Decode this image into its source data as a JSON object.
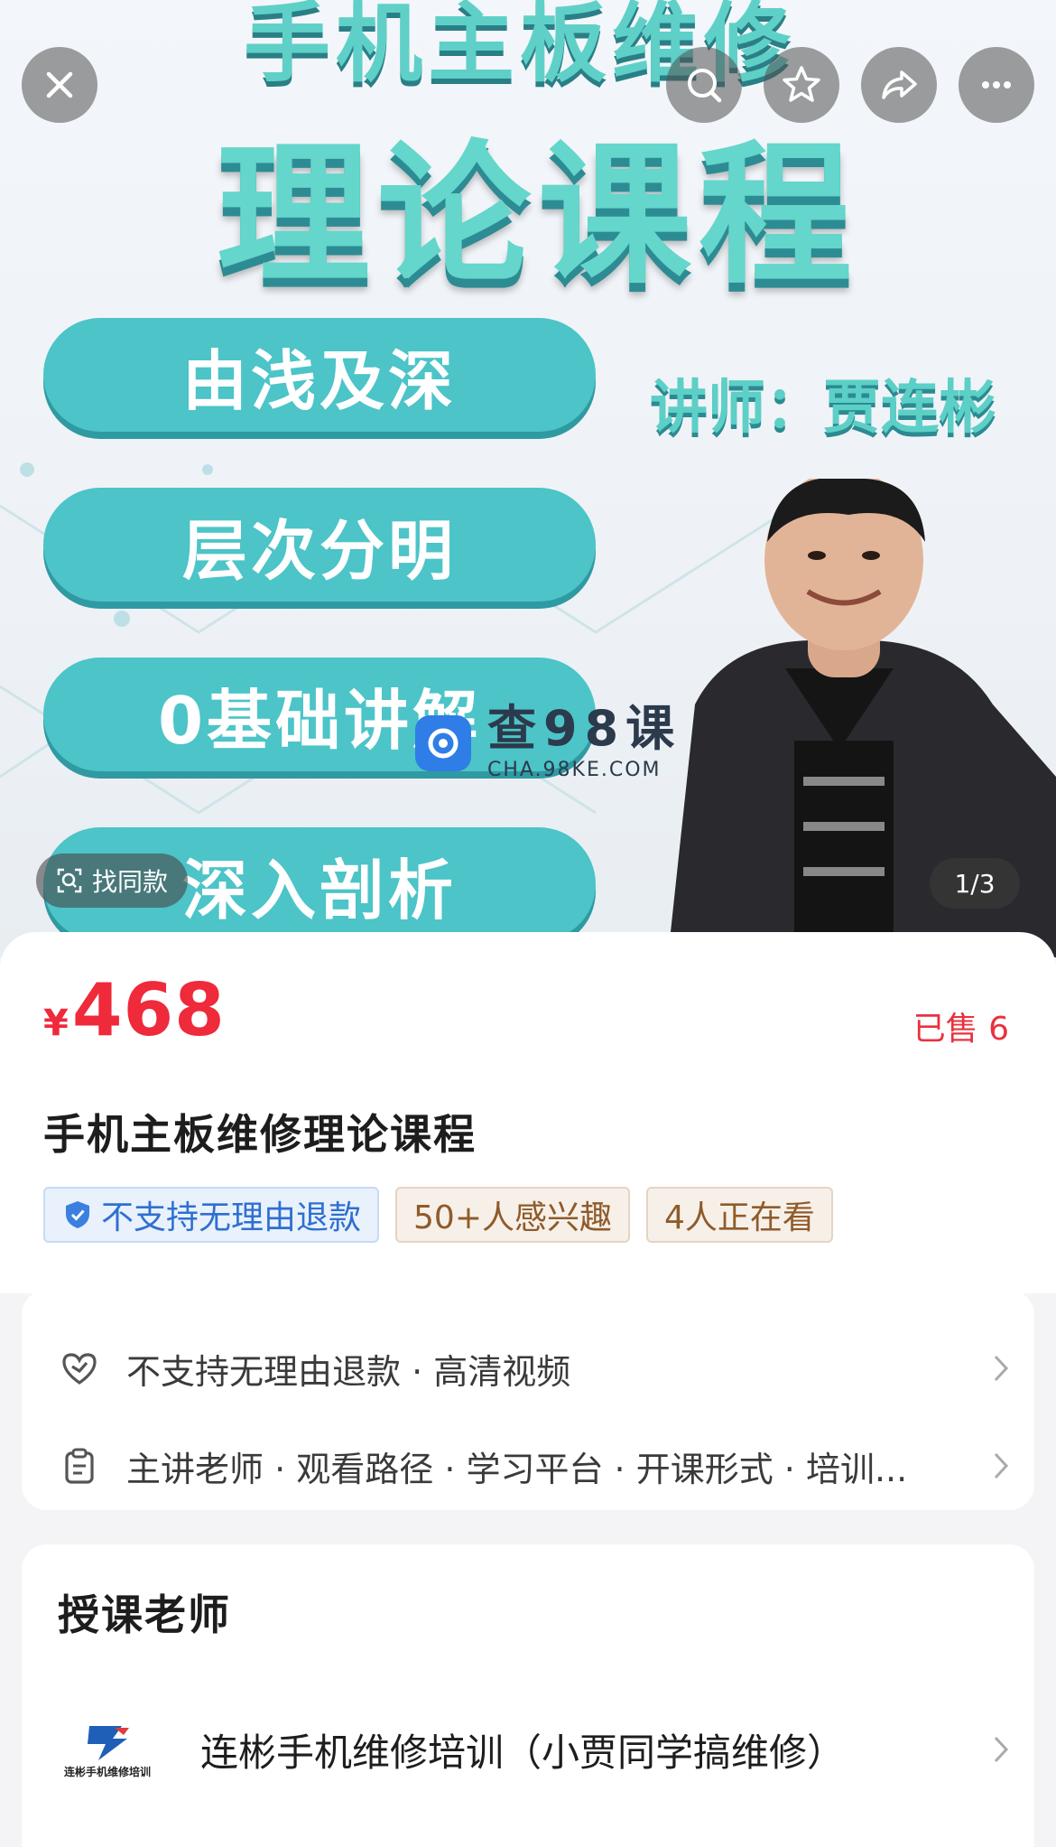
{
  "hero": {
    "top_text": "手机主板维修",
    "title": "理论课程",
    "pills": [
      "由浅及深",
      "层次分明",
      "0基础讲解",
      "深入剖析"
    ],
    "teacher_line": "讲师：贾连彬",
    "watermark_main": "查98课",
    "watermark_sub": "CHA.98KE.COM",
    "find_same": "找同款",
    "pager": "1/3"
  },
  "top_buttons": [
    "close-icon",
    "search-icon",
    "star-icon",
    "share-icon",
    "more-icon"
  ],
  "product": {
    "currency": "¥",
    "price": "468",
    "sold": "已售 6",
    "title": "手机主板维修理论课程",
    "tags": [
      "不支持无理由退款",
      "50+人感兴趣",
      "4人正在看"
    ]
  },
  "info": {
    "row1": "不支持无理由退款 · 高清视频",
    "row2": "主讲老师 · 观看路径 · 学习平台 · 开课形式 · 培训..."
  },
  "teacher": {
    "heading": "授课老师",
    "logo_text": "连彬手机维修培训",
    "name": "连彬手机维修培训（小贾同学搞维修）"
  },
  "colors": {
    "price_red": "#ee2a3b",
    "hero_teal": "#4cc4c8",
    "tag_blue": "#2f6fd0",
    "tag_gold": "#8f5b2a"
  }
}
